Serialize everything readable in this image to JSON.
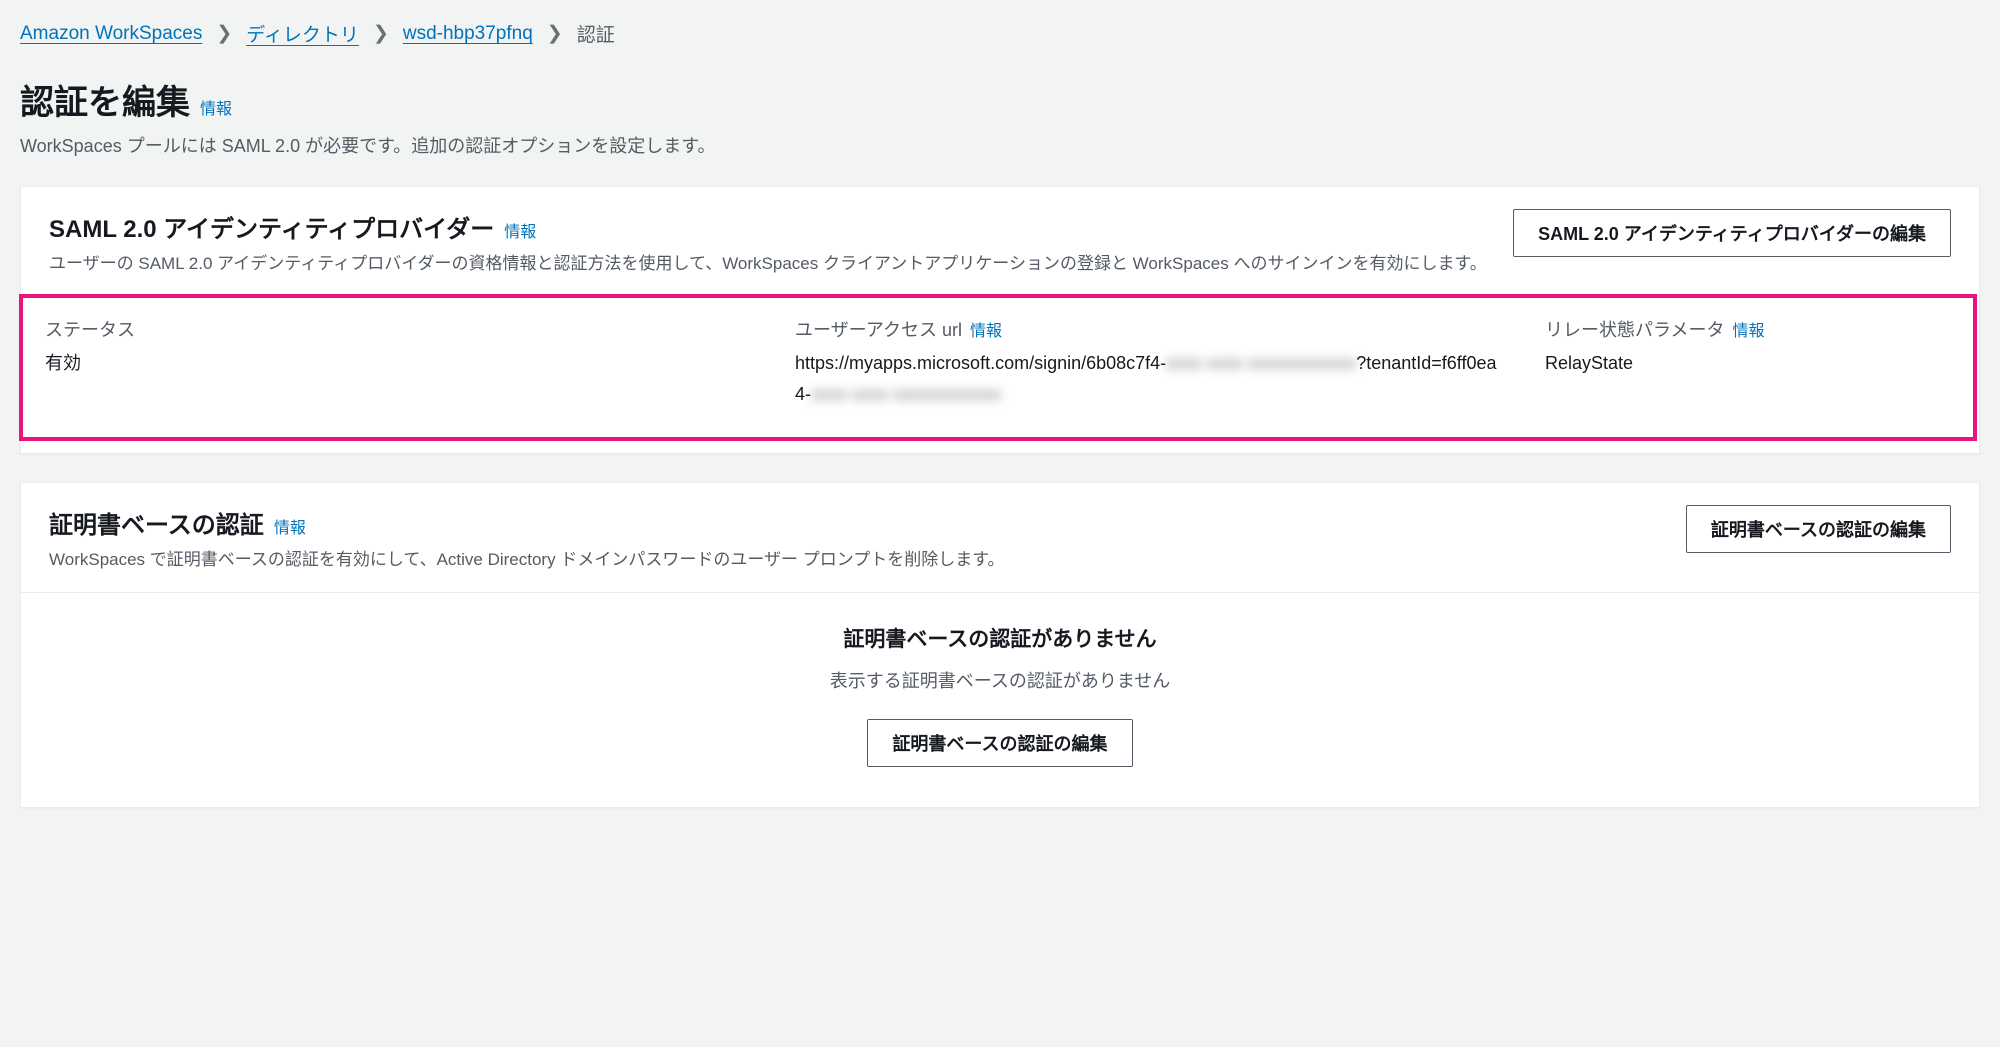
{
  "breadcrumb": {
    "items": [
      {
        "label": "Amazon WorkSpaces",
        "link": true
      },
      {
        "label": "ディレクトリ",
        "link": true
      },
      {
        "label": "wsd-hbp37pfnq",
        "link": true
      },
      {
        "label": "認証",
        "link": false
      }
    ]
  },
  "page": {
    "title": "認証を編集",
    "info": "情報",
    "description": "WorkSpaces プールには SAML 2.0 が必要です。追加の認証オプションを設定します。"
  },
  "saml_panel": {
    "title": "SAML 2.0 アイデンティティプロバイダー",
    "info": "情報",
    "description": "ユーザーの SAML 2.0 アイデンティティプロバイダーの資格情報と認証方法を使用して、WorkSpaces クライアントアプリケーションの登録と WorkSpaces へのサインインを有効にします。",
    "edit_button": "SAML 2.0 アイデンティティプロバイダーの編集",
    "fields": {
      "status": {
        "label": "ステータス",
        "value": "有効"
      },
      "user_access_url": {
        "label": "ユーザーアクセス url",
        "info": "情報",
        "value_part1": "https://myapps.microsoft.com/signin/6b08c7f4-",
        "value_redacted1": "xxxx xxxx xxxxxxxxxxxx",
        "value_part2": "?tenantId=f6ff0ea4-",
        "value_redacted2": "xxxx xxxx xxxxxxxxxxxx"
      },
      "relay_state": {
        "label": "リレー状態パラメータ",
        "info": "情報",
        "value": "RelayState"
      }
    }
  },
  "cert_panel": {
    "title": "証明書ベースの認証",
    "info": "情報",
    "description": "WorkSpaces で証明書ベースの認証を有効にして、Active Directory ドメインパスワードのユーザー プロンプトを削除します。",
    "edit_button": "証明書ベースの認証の編集",
    "empty": {
      "title": "証明書ベースの認証がありません",
      "description": "表示する証明書ベースの認証がありません",
      "button": "証明書ベースの認証の編集"
    }
  }
}
